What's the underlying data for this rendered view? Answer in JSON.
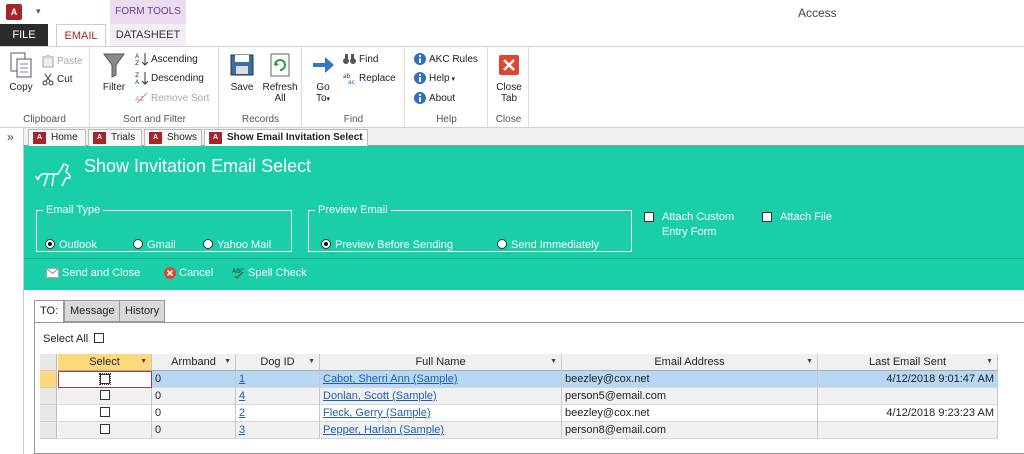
{
  "title_bar": {
    "app_icon_text": "A",
    "qat_arrow": "▾",
    "context_tab_group": "FORM TOOLS",
    "app_title": "Access"
  },
  "ribbon_tabs": {
    "file": "FILE",
    "email": "EMAIL",
    "datasheet": "DATASHEET"
  },
  "ribbon": {
    "clipboard": {
      "label": "Clipboard",
      "copy": "Copy",
      "paste": "Paste",
      "cut": "Cut"
    },
    "sort_filter": {
      "label": "Sort and Filter",
      "filter": "Filter",
      "ascending": "Ascending",
      "descending": "Descending",
      "remove_sort": "Remove Sort"
    },
    "records": {
      "label": "Records",
      "save": "Save",
      "refresh_1": "Refresh",
      "refresh_2": "All"
    },
    "find": {
      "label": "Find",
      "goto_1": "Go",
      "goto_2": "To",
      "find": "Find",
      "replace": "Replace"
    },
    "help": {
      "label": "Help",
      "akc_rules": "AKC Rules",
      "help": "Help",
      "about": "About"
    },
    "close": {
      "label": "Close",
      "close_1": "Close",
      "close_2": "Tab"
    }
  },
  "nav_toggle": "»",
  "doc_tabs": [
    {
      "label": "Home"
    },
    {
      "label": "Trials"
    },
    {
      "label": "Shows"
    },
    {
      "label": "Show Email Invitation Select"
    }
  ],
  "form": {
    "title": "Show Invitation Email Select",
    "email_type": {
      "legend": "Email Type",
      "options": [
        "Outlook",
        "Gmail",
        "Yahoo Mail"
      ],
      "selected": "Outlook"
    },
    "preview_email": {
      "legend": "Preview Email",
      "options": [
        "Preview Before Sending",
        "Send Immediately"
      ],
      "selected": "Preview Before Sending"
    },
    "attach_custom_1": "Attach Custom",
    "attach_custom_2": "Entry Form",
    "attach_file": "Attach File",
    "actions": {
      "send_close": "Send and Close",
      "cancel": "Cancel",
      "spell_check": "Spell Check"
    }
  },
  "body_tabs": [
    "TO:",
    "Message",
    "History"
  ],
  "select_all": "Select All",
  "grid": {
    "headers": [
      "Select",
      "Armband",
      "Dog ID",
      "Full Name",
      "Email Address",
      "Last Email Sent"
    ],
    "rows": [
      {
        "armband": "0",
        "dog_id": "1",
        "full_name": " Cabot, Sherri Ann (Sample)",
        "email": "beezley@cox.net",
        "last_sent": "4/12/2018 9:01:47 AM"
      },
      {
        "armband": "0",
        "dog_id": "4",
        "full_name": " Donlan, Scott (Sample)",
        "email": "person5@email.com",
        "last_sent": ""
      },
      {
        "armband": "0",
        "dog_id": "2",
        "full_name": " Fleck, Gerry (Sample)",
        "email": "beezley@cox.net",
        "last_sent": "4/12/2018 9:23:23 AM"
      },
      {
        "armband": "0",
        "dog_id": "3",
        "full_name": " Pepper, Harlan (Sample)",
        "email": "person8@email.com",
        "last_sent": ""
      }
    ]
  },
  "colors": {
    "access_red": "#a4262c",
    "form_header": "#1acfa8",
    "selected_row": "#b7d8f5",
    "column_highlight": "#fed97c",
    "link": "#1f5fb2"
  }
}
